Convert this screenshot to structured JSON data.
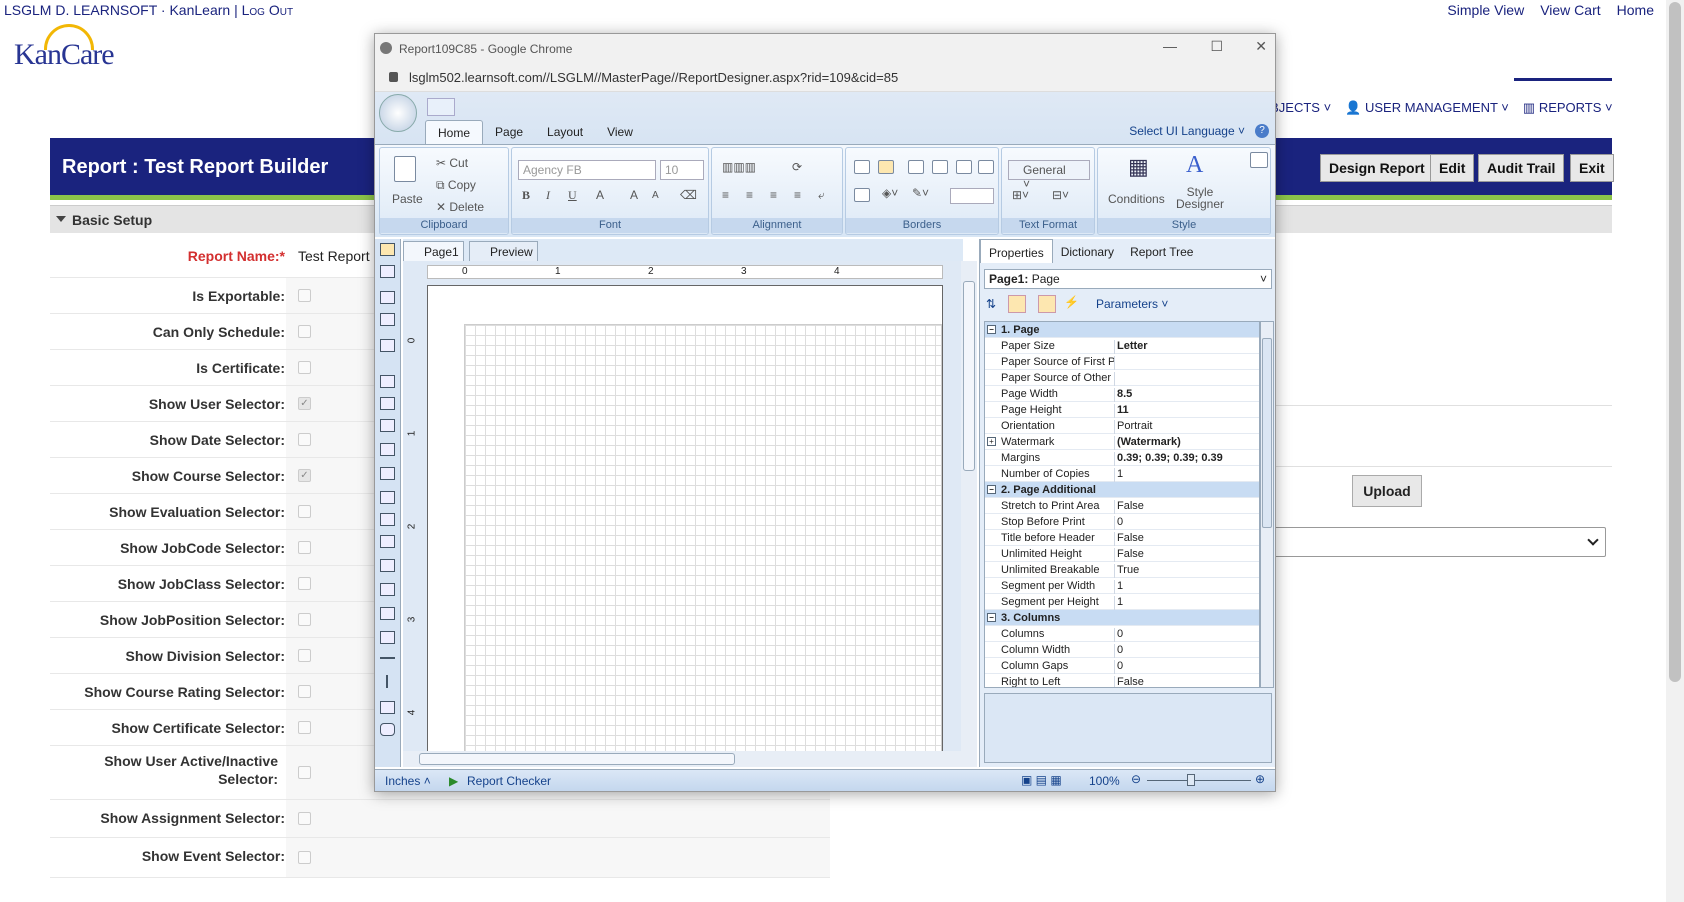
{
  "topbar": {
    "user": "LSGLM D. LEARNSOFT",
    "sep1": "·",
    "app": "KanLearn",
    "sep2": "|",
    "logout": "Log Out"
  },
  "toplinks": [
    "Simple View",
    "View Cart",
    "Home"
  ],
  "logo": {
    "text": "KanCare"
  },
  "nav": {
    "objects": "OBJECTS",
    "user_mgmt": "USER MANAGEMENT",
    "reports": "REPORTS"
  },
  "banner": {
    "title": "Report : Test Report Builder",
    "buttons": [
      "Design Report",
      "Edit",
      "Audit Trail",
      "Exit"
    ]
  },
  "setup": {
    "title": "Basic Setup"
  },
  "form": {
    "report_name_label": "Report Name:*",
    "report_name_value": "Test Report",
    "rows": [
      {
        "label": "Is Exportable:",
        "checked": false
      },
      {
        "label": "Can Only Schedule:",
        "checked": false
      },
      {
        "label": "Is Certificate:",
        "checked": false
      },
      {
        "label": "Show User Selector:",
        "checked": true
      },
      {
        "label": "Show Date Selector:",
        "checked": false
      },
      {
        "label": "Show Course Selector:",
        "checked": true
      },
      {
        "label": "Show Evaluation Selector:",
        "checked": false
      },
      {
        "label": "Show JobCode Selector:",
        "checked": false
      },
      {
        "label": "Show JobClass Selector:",
        "checked": false
      },
      {
        "label": "Show JobPosition Selector:",
        "checked": false
      },
      {
        "label": "Show Division Selector:",
        "checked": false
      },
      {
        "label": "Show Course Rating Selector:",
        "checked": false
      },
      {
        "label": "Show Certificate Selector:",
        "checked": false
      },
      {
        "label": "Show User Active/Inactive Selector:",
        "checked": false
      },
      {
        "label": "Show Assignment Selector:",
        "checked": false
      },
      {
        "label": "Show Event Selector:",
        "checked": false
      }
    ]
  },
  "upload_label": "Upload",
  "popup": {
    "title": "Report109C85 - Google Chrome",
    "url": "lsglm502.learnsoft.com//LSGLM//MasterPage//ReportDesigner.aspx?rid=109&cid=85",
    "ribbon_tabs": [
      "Home",
      "Page",
      "Layout",
      "View"
    ],
    "ui_language": "Select UI Language",
    "clipboard": {
      "paste": "Paste",
      "cut": "Cut",
      "copy": "Copy",
      "delete": "Delete",
      "label": "Clipboard"
    },
    "font": {
      "family": "Agency FB",
      "size": "10",
      "label": "Font"
    },
    "alignment_label": "Alignment",
    "borders_label": "Borders",
    "text_format": {
      "value": "General",
      "label": "Text Format"
    },
    "style": {
      "conditions": "Conditions",
      "style_designer": "Style Designer",
      "label": "Style"
    },
    "doc_tabs": [
      "Page1",
      "Preview"
    ],
    "ruler_ticks": [
      "0",
      "1",
      "2",
      "3",
      "4"
    ],
    "vruler_ticks": [
      "0",
      "1",
      "2",
      "3",
      "4"
    ],
    "prop_tabs": [
      "Properties",
      "Dictionary",
      "Report Tree"
    ],
    "prop_selected": {
      "name": "Page1:",
      "type": "Page"
    },
    "parameters": "Parameters",
    "properties": [
      {
        "cat": "1. Page"
      },
      {
        "n": "Paper Size",
        "v": "Letter",
        "b": true
      },
      {
        "n": "Paper Source of First P",
        "v": ""
      },
      {
        "n": "Paper Source of Other",
        "v": ""
      },
      {
        "n": "Page Width",
        "v": "8.5",
        "b": true
      },
      {
        "n": "Page Height",
        "v": "11",
        "b": true
      },
      {
        "n": "Orientation",
        "v": "Portrait"
      },
      {
        "n": "Watermark",
        "v": "(Watermark)",
        "b": true,
        "exp": true
      },
      {
        "n": "Margins",
        "v": "0.39; 0.39; 0.39; 0.39",
        "b": true
      },
      {
        "n": "Number of Copies",
        "v": "1"
      },
      {
        "cat": "2. Page Additional"
      },
      {
        "n": "Stretch to Print Area",
        "v": "False"
      },
      {
        "n": "Stop Before Print",
        "v": "0"
      },
      {
        "n": "Title before Header",
        "v": "False"
      },
      {
        "n": "Unlimited Height",
        "v": "False"
      },
      {
        "n": "Unlimited Breakable",
        "v": "True"
      },
      {
        "n": "Segment per Width",
        "v": "1"
      },
      {
        "n": "Segment per Height",
        "v": "1"
      },
      {
        "cat": "3. Columns"
      },
      {
        "n": "Columns",
        "v": "0"
      },
      {
        "n": "Column Width",
        "v": "0"
      },
      {
        "n": "Column Gaps",
        "v": "0"
      },
      {
        "n": "Right to Left",
        "v": "False"
      }
    ],
    "status": {
      "units": "Inches",
      "checker": "Report Checker",
      "zoom": "100%"
    }
  }
}
